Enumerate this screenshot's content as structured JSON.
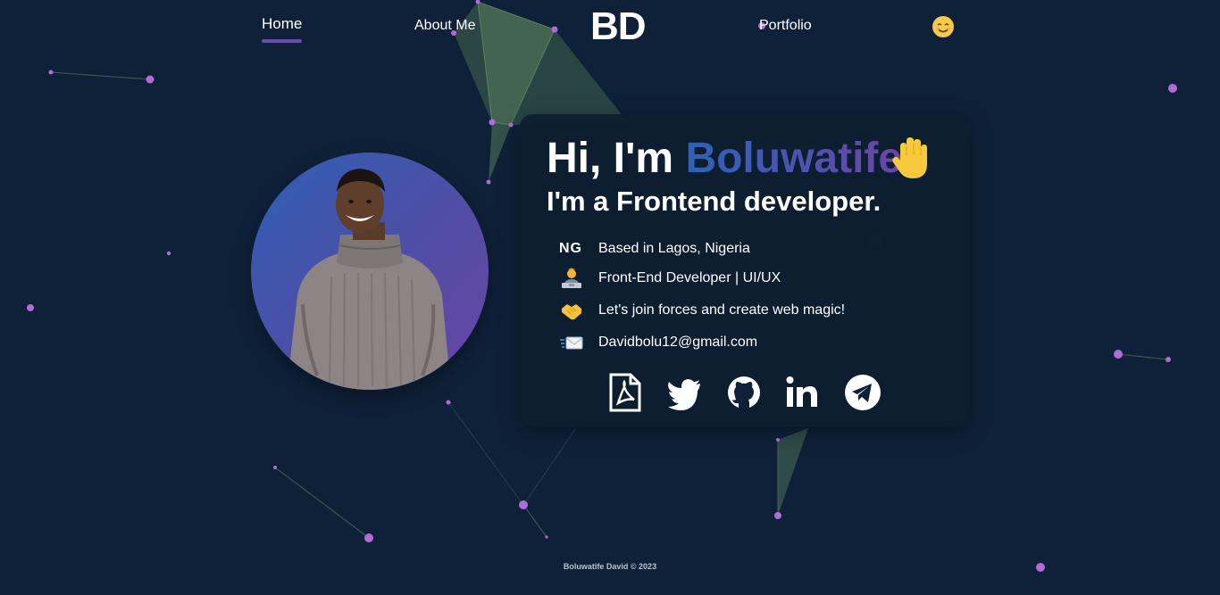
{
  "nav": {
    "home_label": "Home",
    "about_label": "About Me",
    "logo_text": "BD",
    "portfolio_label": "Portfolio",
    "theme_icon": "smiling-face-icon"
  },
  "hero": {
    "greeting_prefix": "Hi, I'm ",
    "greeting_name": "Boluwatife",
    "greeting_icon": "waving-hand-icon",
    "role": "I'm a Frontend developer."
  },
  "info": [
    {
      "icon": "flag-ng",
      "label": "NG",
      "text": "Based in Lagos, Nigeria"
    },
    {
      "icon": "technologist-icon",
      "text": "Front-End Developer | UI/UX"
    },
    {
      "icon": "handshake-icon",
      "text": "Let's join forces and create web magic!"
    },
    {
      "icon": "envelope-icon",
      "text": "Davidbolu12@gmail.com"
    }
  ],
  "socials": [
    "pdf-resume-icon",
    "twitter-icon",
    "github-icon",
    "linkedin-icon",
    "telegram-icon"
  ],
  "footer": "Boluwatife David © 2023",
  "colors": {
    "background": "#0f2139",
    "accent_purple": "#6a4bb0",
    "accent_blue": "#2e62b6",
    "particle": "#b36bd6",
    "network_green": "#6f9c66"
  }
}
